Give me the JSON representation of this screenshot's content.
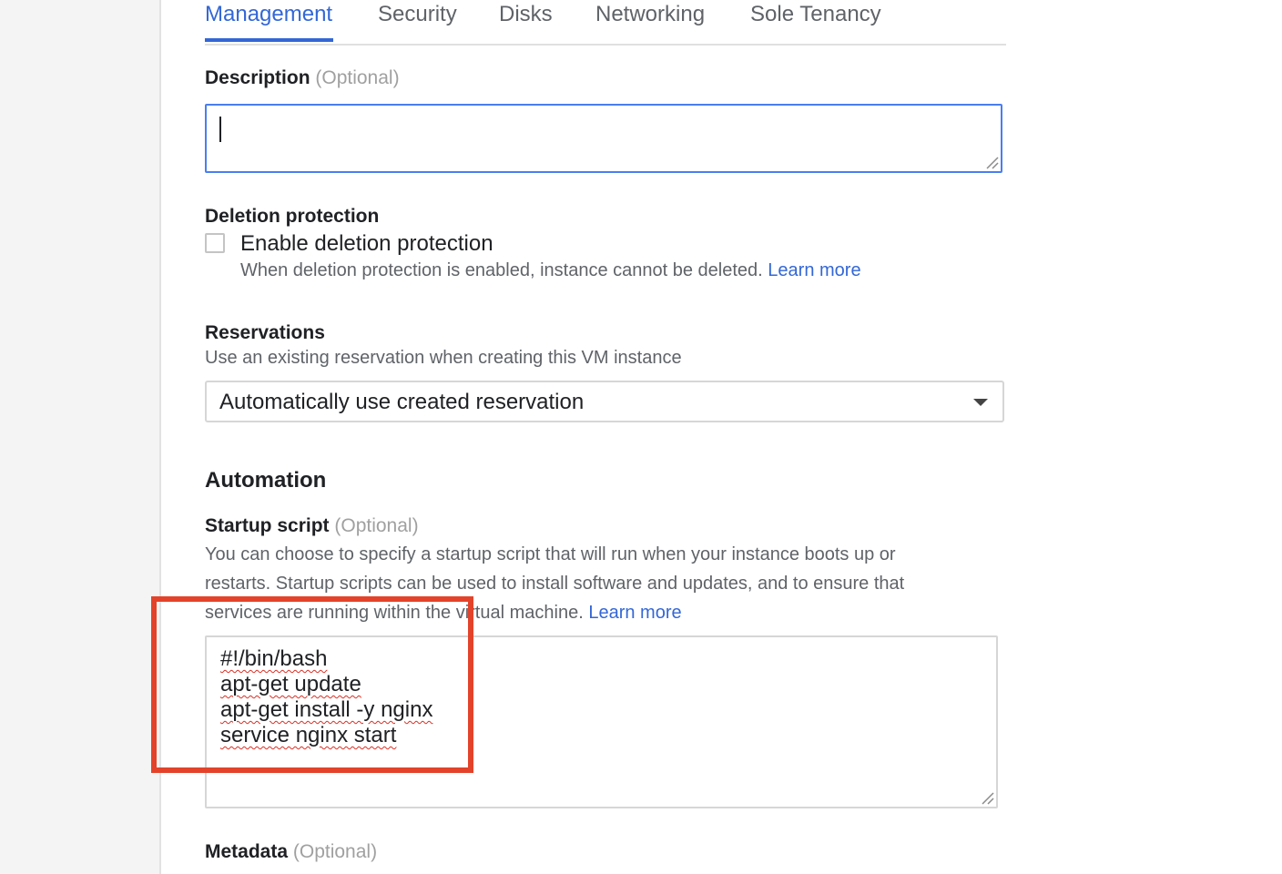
{
  "tabs": [
    {
      "label": "Management",
      "active": true
    },
    {
      "label": "Security",
      "active": false
    },
    {
      "label": "Disks",
      "active": false
    },
    {
      "label": "Networking",
      "active": false
    },
    {
      "label": "Sole Tenancy",
      "active": false
    }
  ],
  "description": {
    "label": "Description",
    "optional": "(Optional)",
    "value": ""
  },
  "deletion_protection": {
    "label": "Deletion protection",
    "checkbox_label": "Enable deletion protection",
    "checked": false,
    "helper": "When deletion protection is enabled, instance cannot be deleted.",
    "link": "Learn more"
  },
  "reservations": {
    "label": "Reservations",
    "helper": "Use an existing reservation when creating this VM instance",
    "selected": "Automatically use created reservation"
  },
  "automation": {
    "heading": "Automation",
    "startup_label": "Startup script",
    "optional": "(Optional)",
    "helper_line1": "You can choose to specify a startup script that will run when your instance boots up or",
    "helper_line2": "restarts. Startup scripts can be used to install software and updates, and to ensure that",
    "helper_line3": "services are running within the virtual machine.",
    "link": "Learn more",
    "script_lines": [
      "#!/bin/bash",
      "apt-get update",
      "apt-get install -y nginx",
      "service nginx start"
    ]
  },
  "metadata": {
    "label": "Metadata",
    "optional": "(Optional)"
  },
  "colors": {
    "accent": "#3367d6",
    "highlight": "#e3432a"
  }
}
